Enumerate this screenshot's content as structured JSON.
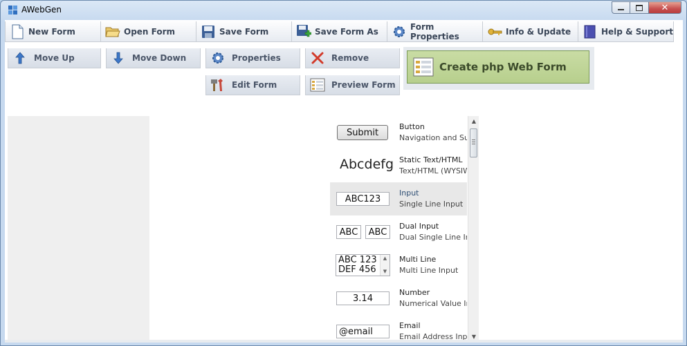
{
  "window": {
    "title": "AWebGen"
  },
  "menu": [
    {
      "label": "New Form",
      "icon": "new-document-icon"
    },
    {
      "label": "Open Form",
      "icon": "open-folder-icon"
    },
    {
      "label": "Save Form",
      "icon": "floppy-disk-icon"
    },
    {
      "label": "Save Form As",
      "icon": "save-as-icon"
    },
    {
      "label": "Form Properties",
      "icon": "gear-icon"
    },
    {
      "label": "Info & Update",
      "icon": "key-icon"
    },
    {
      "label": "Help & Support",
      "icon": "help-book-icon"
    }
  ],
  "toolbar": {
    "move_up": "Move Up",
    "move_down": "Move Down",
    "properties": "Properties",
    "remove": "Remove",
    "edit_form": "Edit Form",
    "preview_form": "Preview Form",
    "create": "Create php Web Form"
  },
  "palette": [
    {
      "title": "Button",
      "subtitle": "Navigation and Submit",
      "preview": "Submit"
    },
    {
      "title": "Static Text/HTML",
      "subtitle": "Text/HTML (WYSIWYG)",
      "preview": "Abcdefg"
    },
    {
      "title": "Input",
      "subtitle": "Single Line Input",
      "preview": "ABC123",
      "selected": true
    },
    {
      "title": "Dual Input",
      "subtitle": "Dual Single Line Input",
      "preview_a": "ABC",
      "preview_b": "ABC"
    },
    {
      "title": "Multi Line",
      "subtitle": "Multi Line Input",
      "line1": "ABC 123",
      "line2": "DEF 456"
    },
    {
      "title": "Number",
      "subtitle": "Numerical Value Input",
      "preview": "3.14"
    },
    {
      "title": "Email",
      "subtitle": "Email Address Input",
      "preview": "@email"
    }
  ],
  "colors": {
    "create_button": "#bcd394",
    "selected_item": "#e8e8e8",
    "accent": "#2f6fbf"
  }
}
